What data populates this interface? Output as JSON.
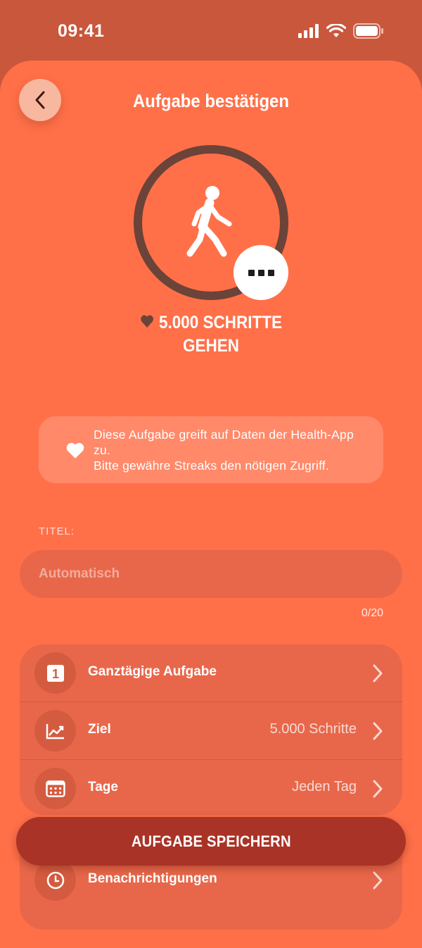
{
  "status_bar": {
    "time": "09:41"
  },
  "header": {
    "title": "Aufgabe bestätigen"
  },
  "task": {
    "name": "5.000 SCHRITTE GEHEN"
  },
  "health_note": {
    "text": "Diese Aufgabe greift auf Daten der Health-App zu.\nBitte gewähre Streaks den nötigen Zugriff."
  },
  "title_field": {
    "label": "TITEL:",
    "placeholder": "Automatisch",
    "counter": "0/20"
  },
  "settings": [
    {
      "icon": "calendar-1-icon",
      "label": "Ganztägige Aufgabe",
      "value": ""
    },
    {
      "icon": "chart-icon",
      "label": "Ziel",
      "value": "5.000 Schritte"
    },
    {
      "icon": "calendar-grid-icon",
      "label": "Tage",
      "value": "Jeden Tag"
    },
    {
      "icon": "clock-icon",
      "label": "Benachrichtigungen",
      "value": ""
    }
  ],
  "save_button": {
    "label": "AUFGABE SPEICHERN"
  },
  "colors": {
    "background": "#FF7049",
    "status_bg": "#C9573C",
    "ring": "#6B4338",
    "save": "#A93326"
  }
}
